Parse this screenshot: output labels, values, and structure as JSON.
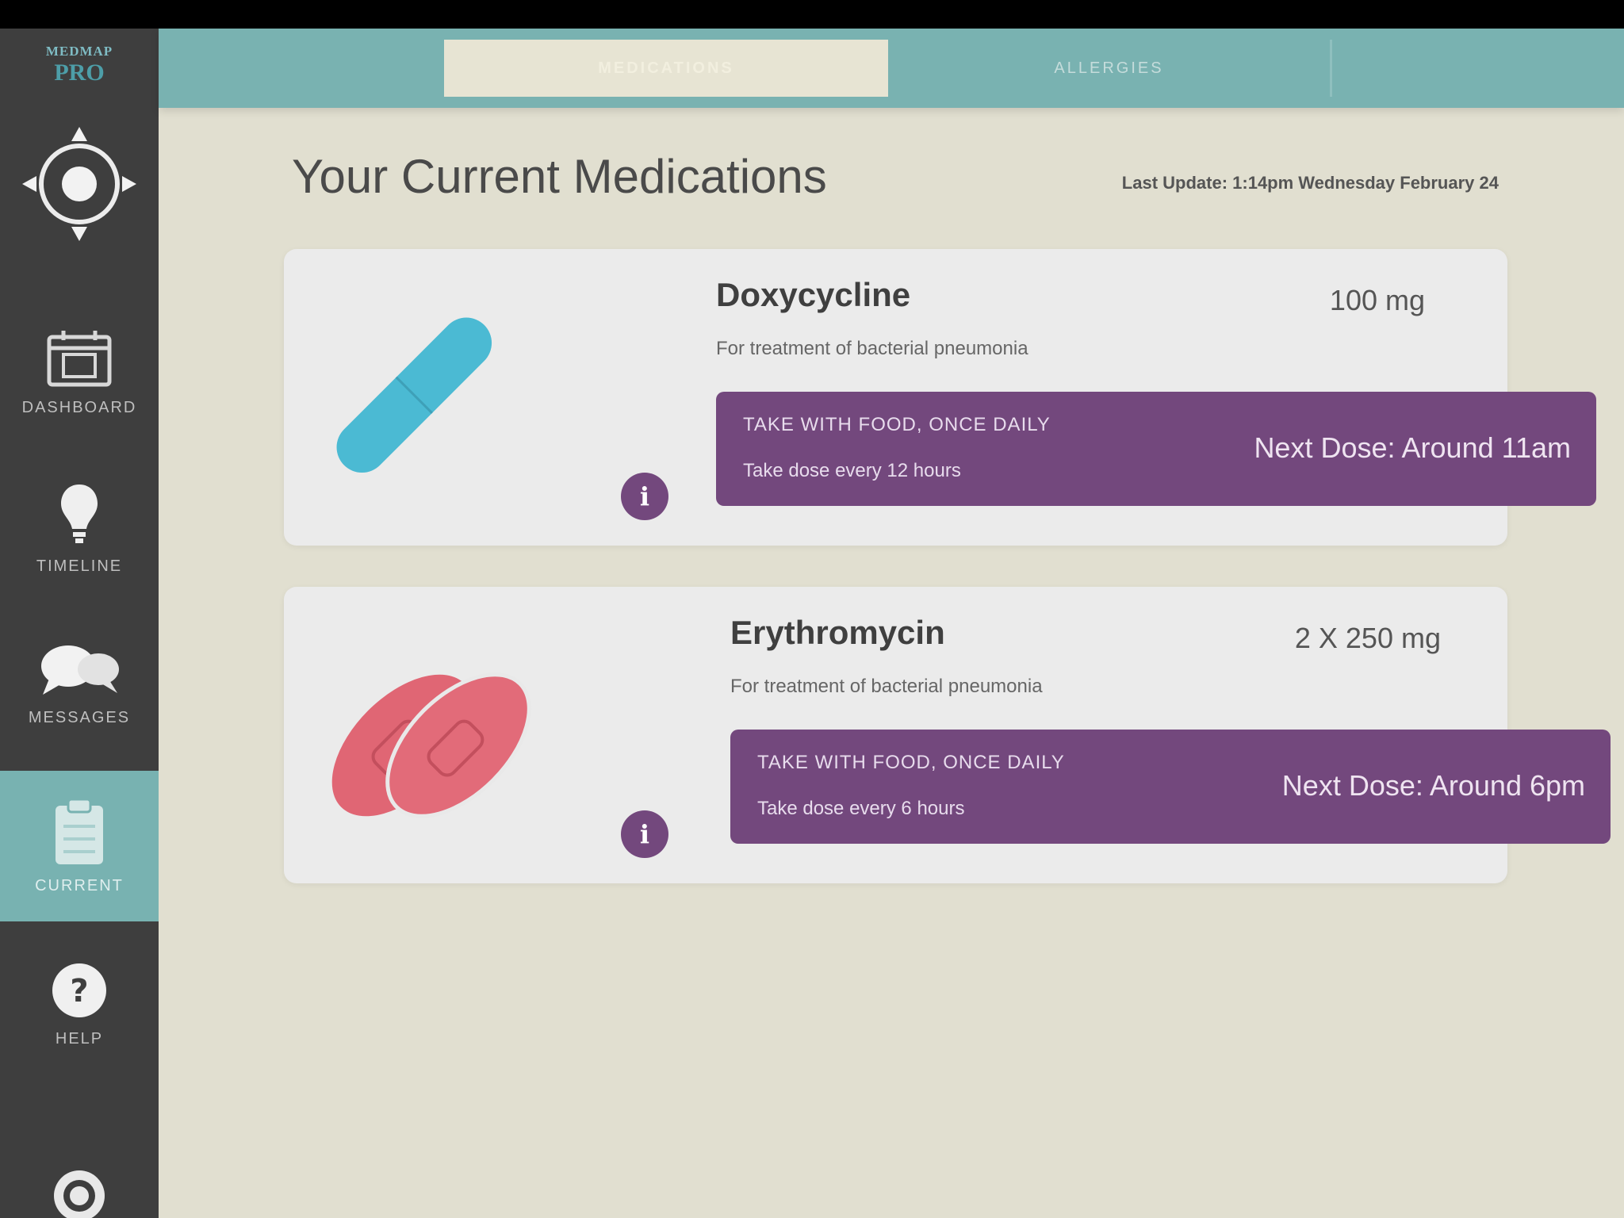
{
  "app": {
    "logo_line1": "MEDMAP",
    "logo_line2": "PRO"
  },
  "sidebar": {
    "items": [
      {
        "label": "Dashboard",
        "icon": "calendar-icon"
      },
      {
        "label": "Timeline",
        "icon": "lightbulb-icon"
      },
      {
        "label": "Messages",
        "icon": "chat-icon"
      },
      {
        "label": "Current",
        "icon": "clipboard-icon",
        "active": true
      },
      {
        "label": "Help",
        "icon": "question-icon"
      }
    ],
    "settings_icon": "gear-icon"
  },
  "tabs": [
    {
      "label": "Medications",
      "active": true
    },
    {
      "label": "Allergies",
      "active": false
    }
  ],
  "page": {
    "title": "Your Current Medications",
    "last_updated": "Last Update: 1:14pm Wednesday February 24"
  },
  "medications": [
    {
      "name": "Doxycycline",
      "dose": "100 mg",
      "description": "For treatment of bacterial pneumonia",
      "instruction_line1": "Take with food, once daily",
      "instruction_line2": "Take dose every 12 hours",
      "next_dose": "Next Dose: Around 11am",
      "pill_color": "#4bbad3",
      "info_badge": "i"
    },
    {
      "name": "Erythromycin",
      "dose": "2 X 250 mg",
      "description": "For treatment of bacterial pneumonia",
      "instruction_line1": "Take with food, once daily",
      "instruction_line2": "Take dose every 6 hours",
      "next_dose": "Next Dose: Around 6pm",
      "pill_color": "#e06674",
      "info_badge": "i"
    }
  ],
  "colors": {
    "sidebar": "#3e3e3e",
    "accent_teal": "#78b2b1",
    "background": "#e1dfd0",
    "card": "#ebebeb",
    "instruction_purple": "#73487d"
  }
}
